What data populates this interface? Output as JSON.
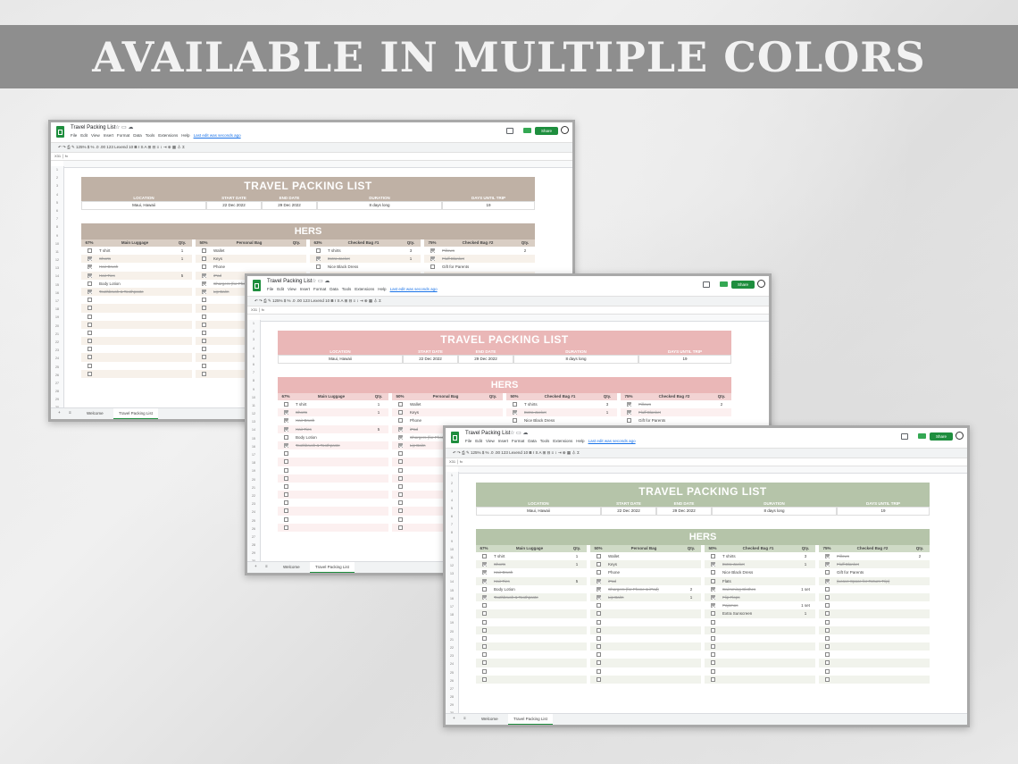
{
  "banner": {
    "text": "AVAILABLE IN MULTIPLE COLORS"
  },
  "app": {
    "doc_title": "Travel Packing List",
    "menu": [
      "File",
      "Edit",
      "View",
      "Insert",
      "Format",
      "Data",
      "Tools",
      "Extensions",
      "Help"
    ],
    "last_edit": "Last edit was seconds ago",
    "share_label": "Share",
    "toolbar_zoom": "125%",
    "toolbar_font": "Lexend",
    "toolbar_size": "10",
    "cell_ref": "X31",
    "tabs": [
      "Welcome",
      "Travel Packing List"
    ]
  },
  "sheet": {
    "title": "TRAVEL PACKING LIST",
    "info_headers": [
      "LOCATION",
      "START DATE",
      "END DATE",
      "DURATION",
      "DAYS UNTIL TRIP"
    ],
    "info_values": [
      "Maui, Hawaii",
      "22 Dec 2022",
      "29 Dec 2022",
      "8 days long",
      "19"
    ],
    "section_title": "HERS",
    "qty_label": "Qty."
  },
  "windows": [
    {
      "theme": "beige",
      "columns": [
        {
          "pct": "67%",
          "name": "Main Luggage",
          "items": [
            {
              "n": "T shirt",
              "q": "1",
              "c": false
            },
            {
              "n": "Shorts",
              "q": "1",
              "c": true
            },
            {
              "n": "Hair Brush",
              "q": "",
              "c": true
            },
            {
              "n": "Hair Ties",
              "q": "5",
              "c": true
            },
            {
              "n": "Body Lotion",
              "q": "",
              "c": false
            },
            {
              "n": "Toothbrush & Toothpaste",
              "q": "",
              "c": true
            }
          ]
        },
        {
          "pct": "50%",
          "name": "Personal Bag",
          "items": [
            {
              "n": "Wallet",
              "q": "",
              "c": false
            },
            {
              "n": "Keys",
              "q": "",
              "c": false
            },
            {
              "n": "Phone",
              "q": "",
              "c": false
            },
            {
              "n": "iPad",
              "q": "",
              "c": true
            },
            {
              "n": "Chargers (for Phone & iPad)",
              "q": "",
              "c": true
            },
            {
              "n": "Lip Balm",
              "q": "",
              "c": true
            }
          ]
        },
        {
          "pct": "63%",
          "name": "Checked Bag #1",
          "items": [
            {
              "n": "T shirts",
              "q": "3",
              "c": false
            },
            {
              "n": "Extra Jacket",
              "q": "1",
              "c": true
            },
            {
              "n": "Nice Black Dress",
              "q": "",
              "c": false
            }
          ]
        },
        {
          "pct": "75%",
          "name": "Checked Bag #2",
          "items": [
            {
              "n": "Pillows",
              "q": "2",
              "c": true
            },
            {
              "n": "Fluff Blanket",
              "q": "",
              "c": true
            },
            {
              "n": "Gift for Parents",
              "q": "",
              "c": false
            }
          ]
        }
      ]
    },
    {
      "theme": "pink",
      "columns": [
        {
          "pct": "67%",
          "name": "Main Luggage",
          "items": [
            {
              "n": "T shirt",
              "q": "1",
              "c": false
            },
            {
              "n": "Shorts",
              "q": "1",
              "c": true
            },
            {
              "n": "Hair Brush",
              "q": "",
              "c": true
            },
            {
              "n": "Hair Ties",
              "q": "5",
              "c": true
            },
            {
              "n": "Body Lotion",
              "q": "",
              "c": false
            },
            {
              "n": "Toothbrush & Toothpaste",
              "q": "",
              "c": true
            }
          ]
        },
        {
          "pct": "50%",
          "name": "Personal Bag",
          "items": [
            {
              "n": "Wallet",
              "q": "",
              "c": false
            },
            {
              "n": "Keys",
              "q": "",
              "c": false
            },
            {
              "n": "Phone",
              "q": "",
              "c": false
            },
            {
              "n": "iPad",
              "q": "",
              "c": true
            },
            {
              "n": "Chargers (for Phone & iPad)",
              "q": "",
              "c": true
            },
            {
              "n": "Lip Balm",
              "q": "",
              "c": true
            }
          ]
        },
        {
          "pct": "50%",
          "name": "Checked Bag #1",
          "items": [
            {
              "n": "T shirts",
              "q": "3",
              "c": false
            },
            {
              "n": "Extra Jacket",
              "q": "1",
              "c": true
            },
            {
              "n": "Nice Black Dress",
              "q": "",
              "c": false
            }
          ]
        },
        {
          "pct": "75%",
          "name": "Checked Bag #2",
          "items": [
            {
              "n": "Pillows",
              "q": "2",
              "c": true
            },
            {
              "n": "Fluff Blanket",
              "q": "",
              "c": true
            },
            {
              "n": "Gift for Parents",
              "q": "",
              "c": false
            }
          ]
        }
      ]
    },
    {
      "theme": "green",
      "columns": [
        {
          "pct": "67%",
          "name": "Main Luggage",
          "items": [
            {
              "n": "T shirt",
              "q": "1",
              "c": false
            },
            {
              "n": "Shorts",
              "q": "1",
              "c": true
            },
            {
              "n": "Hair Brush",
              "q": "",
              "c": true
            },
            {
              "n": "Hair Ties",
              "q": "5",
              "c": true
            },
            {
              "n": "Body Lotion",
              "q": "",
              "c": false
            },
            {
              "n": "Toothbrush & Toothpaste",
              "q": "",
              "c": true
            }
          ]
        },
        {
          "pct": "50%",
          "name": "Personal Bag",
          "items": [
            {
              "n": "Wallet",
              "q": "",
              "c": false
            },
            {
              "n": "Keys",
              "q": "",
              "c": false
            },
            {
              "n": "Phone",
              "q": "",
              "c": false
            },
            {
              "n": "iPad",
              "q": "",
              "c": true
            },
            {
              "n": "Chargers (for Phone & iPad)",
              "q": "2",
              "c": true
            },
            {
              "n": "Lip Balm",
              "q": "1",
              "c": true
            }
          ]
        },
        {
          "pct": "50%",
          "name": "Checked Bag #1",
          "items": [
            {
              "n": "T shirts",
              "q": "3",
              "c": false
            },
            {
              "n": "Extra Jacket",
              "q": "1",
              "c": true
            },
            {
              "n": "Nice Black Dress",
              "q": "",
              "c": false
            },
            {
              "n": "Flats",
              "q": "",
              "c": false
            },
            {
              "n": "Swimming Clothes",
              "q": "1 set",
              "c": true
            },
            {
              "n": "Flip Flops",
              "q": "",
              "c": true
            },
            {
              "n": "Pajamas",
              "q": "1 set",
              "c": true
            },
            {
              "n": "Extra Sunscreen",
              "q": "1",
              "c": false
            }
          ]
        },
        {
          "pct": "75%",
          "name": "Checked Bag #2",
          "items": [
            {
              "n": "Pillows",
              "q": "2",
              "c": true
            },
            {
              "n": "Fluff Blanket",
              "q": "",
              "c": true
            },
            {
              "n": "Gift for Parents",
              "q": "",
              "c": false
            },
            {
              "n": "(Leave Space for Return Trip)",
              "q": "",
              "c": true
            }
          ]
        }
      ]
    }
  ]
}
